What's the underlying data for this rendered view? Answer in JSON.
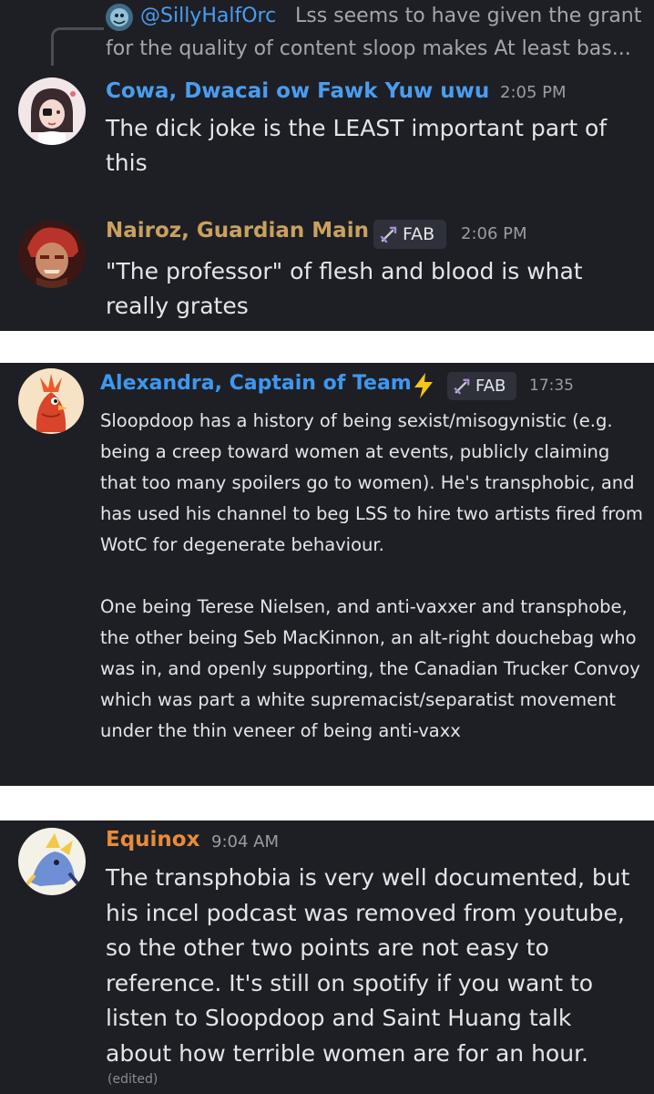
{
  "messages": [
    {
      "reply": {
        "user": "@SillyHalfOrc",
        "line1": "Lss seems to have given the grant",
        "line2": "for the quality of content sloop makes  At least bas..."
      },
      "author": "Cowa, Dwacai ow Fawk Yuw uwu",
      "time": "2:05 PM",
      "text": "The dick joke is the LEAST important part of this",
      "name_color": "#4a9df0"
    },
    {
      "author": "Nairoz, Guardian Main",
      "tag": "FAB",
      "time": "2:06 PM",
      "text": "\"The professor\" of flesh and blood is what really grates",
      "name_color": "#c9a160"
    },
    {
      "author": "Alexandra, Captain of Team",
      "tag": "FAB",
      "time": "17:35",
      "paragraph1": "Sloopdoop has a history of being sexist/misogynistic (e.g. being a creep toward women at events, publicly claiming that too many spoilers go to women). He's transphobic, and has used his channel to beg LSS to hire two artists fired from WotC for degenerate behaviour.",
      "paragraph2": "One being Terese Nielsen, and anti-vaxxer and transphobe, the other being Seb MacKinnon, an alt-right douchebag who was in, and openly supporting, the Canadian Trucker Convoy which was part a white supremacist/separatist movement under the thin veneer of being anti-vaxx",
      "name_color": "#3e97ef"
    },
    {
      "author": "Equinox",
      "time": "9:04 AM",
      "text": "The transphobia is very well documented, but his incel podcast was removed from youtube, so the other two points are not easy to reference. It's still on spotify if you want to listen to Sloopdoop and Saint Huang talk about how terrible women are for an hour.",
      "edited": "(edited)",
      "name_color": "#e88b3c"
    }
  ],
  "icons": {
    "tag_icon": "sword-icon",
    "name_suffix_icon": "lightning-bolt-icon"
  },
  "colors": {
    "background": "#1e1f25",
    "separator": "#ffffff",
    "tag_background": "#2f313a",
    "timestamp": "#9a9ca3"
  }
}
